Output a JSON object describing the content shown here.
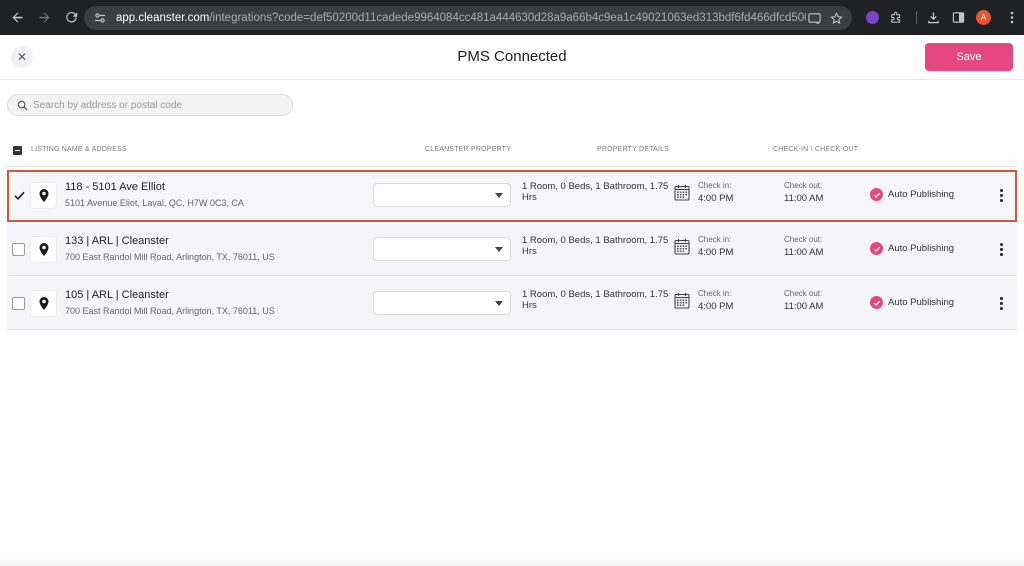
{
  "browser": {
    "url_host": "app.cleanster.com",
    "url_path": "/integrations?code=def50200d11cadede9964084cc481a444630d28a9a66b4c9ea1c49021063ed313bdf6fd466dfcd5006848587...",
    "profile_initial": "A"
  },
  "header": {
    "title": "PMS Connected",
    "close_glyph": "✕",
    "save_label": "Save"
  },
  "search": {
    "placeholder": "Search by address or postal code",
    "value": ""
  },
  "table": {
    "columns": [
      "LISTING NAME & ADDRESS",
      "CLEANSTER PROPERTY",
      "PROPERTY DETAILS",
      "CHECK-IN \\ CHECK-OUT"
    ],
    "rows": [
      {
        "name": "118 - 5101 Ave Elliot",
        "address": "5101 Avenue Eliot, Laval, QC, H7W 0C3, CA",
        "cleanster_property": "",
        "details": "1 Room, 0 Beds, 1 Bathroom, 1.75 Hrs",
        "checkin_label": "Check in:",
        "checkin_time": "4:00 PM",
        "checkout_label": "Check out:",
        "checkout_time": "11:00 AM",
        "publish_label": "Auto Publishing",
        "selected": true
      },
      {
        "name": "133 | ARL | Cleanster",
        "address": "700 East Randol Mill Road, Arlington, TX, 76011, US",
        "cleanster_property": "",
        "details": "1 Room, 0 Beds, 1 Bathroom, 1.75 Hrs",
        "checkin_label": "Check in:",
        "checkin_time": "4:00 PM",
        "checkout_label": "Check out:",
        "checkout_time": "11:00 AM",
        "publish_label": "Auto Publishing",
        "selected": false
      },
      {
        "name": "105 | ARL | Cleanster",
        "address": "700 East Randol Mill Road, Arlington, TX, 76011, US",
        "cleanster_property": "",
        "details": "1 Room, 0 Beds, 1 Bathroom, 1.75 Hrs",
        "checkin_label": "Check in:",
        "checkin_time": "4:00 PM",
        "checkout_label": "Check out:",
        "checkout_time": "11:00 AM",
        "publish_label": "Auto Publishing",
        "selected": false
      }
    ]
  },
  "colors": {
    "accent": "#e5487f",
    "selection_border": "#e4513a",
    "chrome_bg": "#202124"
  }
}
